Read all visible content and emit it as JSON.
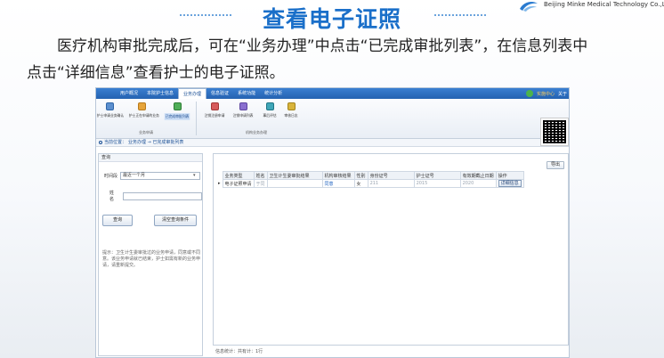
{
  "slide": {
    "title": "查看电子证照",
    "brand_text": "Beijing Minke Medical Technology Co.,Ltd",
    "instruction_line1": "医疗机构审批完成后，可在“业务办理”中点击“已完成审批列表”，在信息列表中",
    "instruction_line2": "点击“详细信息”查看护士的电子证照。",
    "accent_color": "#1a6fc9"
  },
  "app": {
    "menu": {
      "items": [
        "用户概况",
        "本院护士信息",
        "业务办理",
        "信息验证",
        "系统功能",
        "统计分析"
      ],
      "active": "业务办理",
      "right": {
        "help_label": "实施中心",
        "other_label": "关于"
      }
    },
    "ribbon": {
      "buttons": [
        {
          "label": "护士申请业务确认",
          "icon": "confirm-icon"
        },
        {
          "label": "护士正在申请的业务",
          "icon": "pending-icon"
        },
        {
          "label": "已完成审批列表",
          "icon": "completed-list-icon",
          "highlight": true
        },
        {
          "label": "注销注册申请",
          "icon": "cancel-register-icon"
        },
        {
          "label": "注销申请列表",
          "icon": "cancel-list-icon"
        },
        {
          "label": "事后评估",
          "icon": "evaluate-icon"
        },
        {
          "label": "审核日志",
          "icon": "log-icon"
        }
      ],
      "groups": {
        "business": "业务申请",
        "institution": "机构业务办理"
      }
    },
    "breadcrumb": {
      "prefix": "当前位置：",
      "path": "业务办理 → 已完成审批列表"
    },
    "query": {
      "title": "查询",
      "time_label": "时间段",
      "time_value": "最近一个月",
      "name_label": "姓名",
      "search_button": "查询",
      "clear_button": "清空查询条件",
      "tip": "提示：卫生计生委审批过的业务申请，同意或不同意。该业务申请就已结束，护士如需有新的业务申请，请重新提交。"
    },
    "results": {
      "export_button": "导出",
      "columns": [
        "业务类型",
        "姓名",
        "卫生计生委审批结果",
        "机构审核结果",
        "性别",
        "身份证号",
        "护士证号",
        "有效期截止日期",
        "操作"
      ],
      "rows": [
        {
          "marker": "▸",
          "type": "电子证照申请",
          "name": "于同",
          "commission_result": "",
          "institution_result": "同意",
          "gender": "女",
          "id_number": "211",
          "nurse_no": "2015",
          "expiry": "2020",
          "action": "详细信息"
        }
      ]
    },
    "footer": "信息统计：共有计：1行"
  }
}
